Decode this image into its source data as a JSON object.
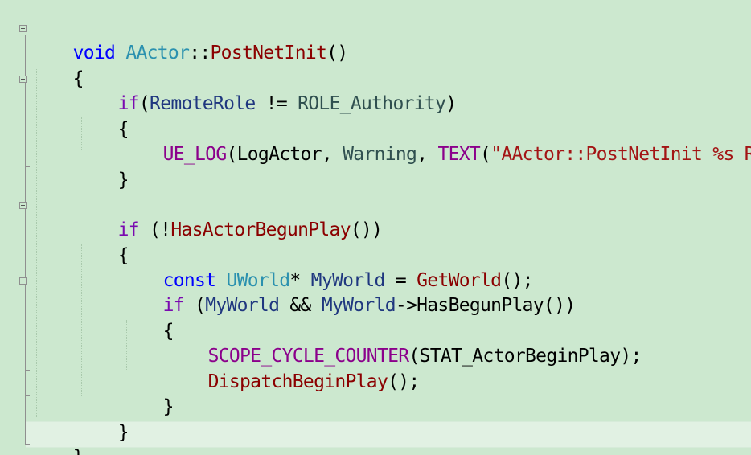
{
  "editor": {
    "background": "#cce8cf",
    "colors": {
      "keyword": "#7a0ab0",
      "keyword_blue": "#0000ff",
      "type": "#2b91af",
      "function": "#8b0000",
      "variable": "#1f377f",
      "enum": "#2f4f4f",
      "macro": "#8b008b",
      "string": "#a31515"
    },
    "lines": {
      "l1": {
        "void": "void",
        "cls": "AActor",
        "sep": "::",
        "fn": "PostNetInit",
        "rest": "()"
      },
      "l2": {
        "text": "{"
      },
      "l3": {
        "kw": "if",
        "open": "(",
        "var": "RemoteRole",
        "op": " != ",
        "enum": "ROLE_Authority",
        "close": ")"
      },
      "l4": {
        "text": "{"
      },
      "l5": {
        "macro": "UE_LOG",
        "open": "(",
        "cat": "LogActor",
        "c1": ", ",
        "verb": "Warning",
        "c2": ", ",
        "textm": "TEXT",
        "p": "(",
        "str": "\"AActor::PostNetInit %s R"
      },
      "l6": {
        "text": "}"
      },
      "l8": {
        "kw": "if",
        "open": " (!",
        "fn": "HasActorBegunPlay",
        "close": "())"
      },
      "l9": {
        "text": "{"
      },
      "l10": {
        "const": "const",
        "type": " UWorld",
        "star": "* ",
        "var": "MyWorld",
        "eq": " = ",
        "fn": "GetWorld",
        "end": "();"
      },
      "l11": {
        "kw": "if",
        "open": " (",
        "var1": "MyWorld",
        "and": " && ",
        "var2": "MyWorld",
        "arrow": "->",
        "fn": "HasBegunPlay",
        "close": "())"
      },
      "l12": {
        "text": "{"
      },
      "l13": {
        "macro": "SCOPE_CYCLE_COUNTER",
        "open": "(",
        "arg": "STAT_ActorBeginPlay",
        "close": ");"
      },
      "l14": {
        "fn": "DispatchBeginPlay",
        "close": "();"
      },
      "l15": {
        "text": "}"
      },
      "l16": {
        "text": "}"
      },
      "l17": {
        "text": "}"
      }
    }
  }
}
